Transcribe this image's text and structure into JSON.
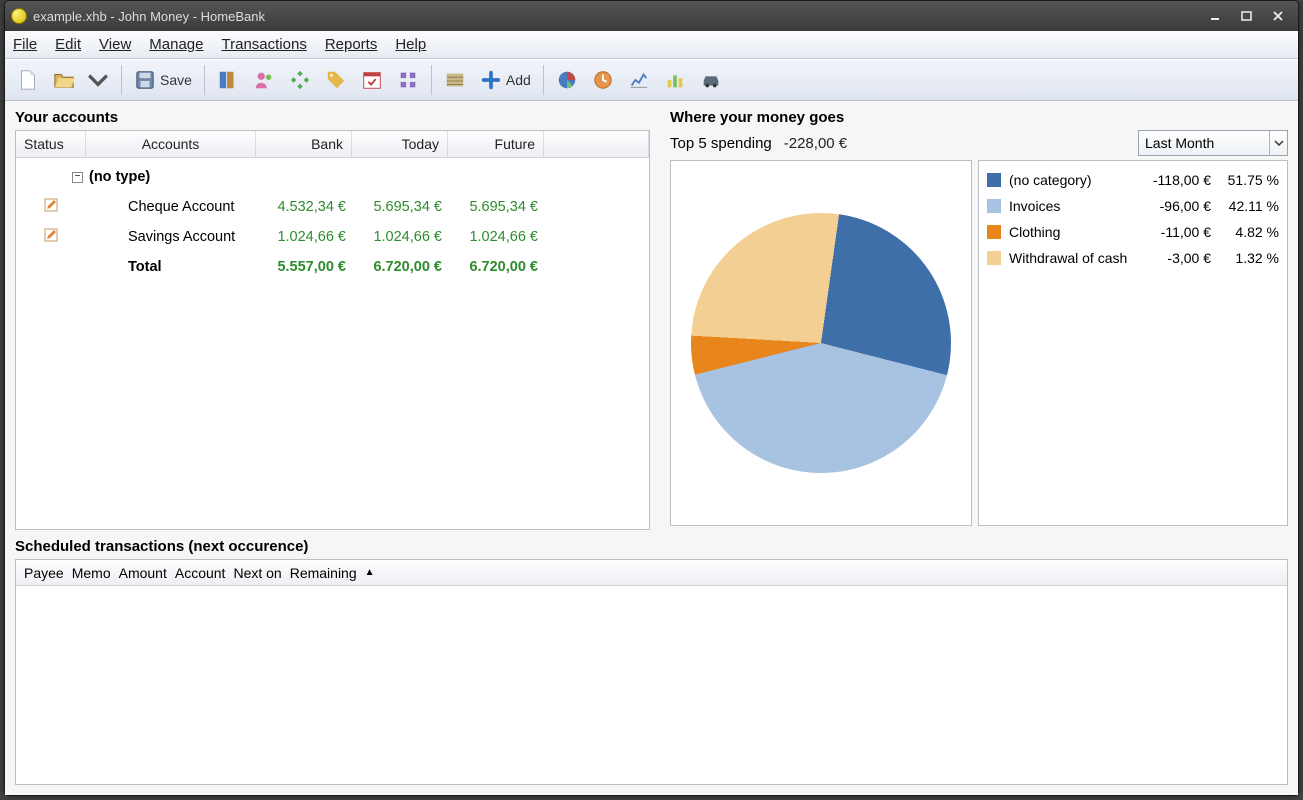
{
  "window": {
    "title": "example.xhb - John Money - HomeBank"
  },
  "menu": {
    "file": "File",
    "edit": "Edit",
    "view": "View",
    "manage": "Manage",
    "transactions": "Transactions",
    "reports": "Reports",
    "help": "Help"
  },
  "toolbar": {
    "save": "Save",
    "add": "Add"
  },
  "accounts": {
    "title": "Your accounts",
    "headers": {
      "status": "Status",
      "accounts": "Accounts",
      "bank": "Bank",
      "today": "Today",
      "future": "Future"
    },
    "group": "(no type)",
    "rows": [
      {
        "name": "Cheque Account",
        "bank": "4.532,34 €",
        "today": "5.695,34 €",
        "future": "5.695,34 €"
      },
      {
        "name": "Savings Account",
        "bank": "1.024,66 €",
        "today": "1.024,66 €",
        "future": "1.024,66 €"
      }
    ],
    "total": {
      "label": "Total",
      "bank": "5.557,00 €",
      "today": "6.720,00 €",
      "future": "6.720,00 €"
    }
  },
  "spending": {
    "title": "Where your money goes",
    "subtitle": "Top 5 spending",
    "amount": "-228,00 €",
    "range": "Last Month",
    "legend": [
      {
        "color": "#3f6fa8",
        "name": "(no category)",
        "amount": "-118,00 €",
        "pct": "51.75 %"
      },
      {
        "color": "#a8c2e2",
        "name": "Invoices",
        "amount": "-96,00 €",
        "pct": "42.11 %"
      },
      {
        "color": "#e8861b",
        "name": "Clothing",
        "amount": "-11,00 €",
        "pct": "4.82 %"
      },
      {
        "color": "#f3cf93",
        "name": "Withdrawal of cash",
        "amount": "-3,00 €",
        "pct": "1.32 %"
      }
    ]
  },
  "scheduled": {
    "title": "Scheduled transactions (next occurence)",
    "headers": [
      "Payee",
      "Memo",
      "Amount",
      "Account",
      "Next on",
      "Remaining"
    ]
  },
  "chart_data": {
    "type": "pie",
    "title": "Top 5 spending",
    "series": [
      {
        "name": "(no category)",
        "value": 118.0,
        "pct": 51.75,
        "color": "#3f6fa8"
      },
      {
        "name": "Invoices",
        "value": 96.0,
        "pct": 42.11,
        "color": "#a8c2e2"
      },
      {
        "name": "Clothing",
        "value": 11.0,
        "pct": 4.82,
        "color": "#e8861b"
      },
      {
        "name": "Withdrawal of cash",
        "value": 3.0,
        "pct": 1.32,
        "color": "#f3cf93"
      }
    ],
    "total": -228.0,
    "currency": "€"
  }
}
